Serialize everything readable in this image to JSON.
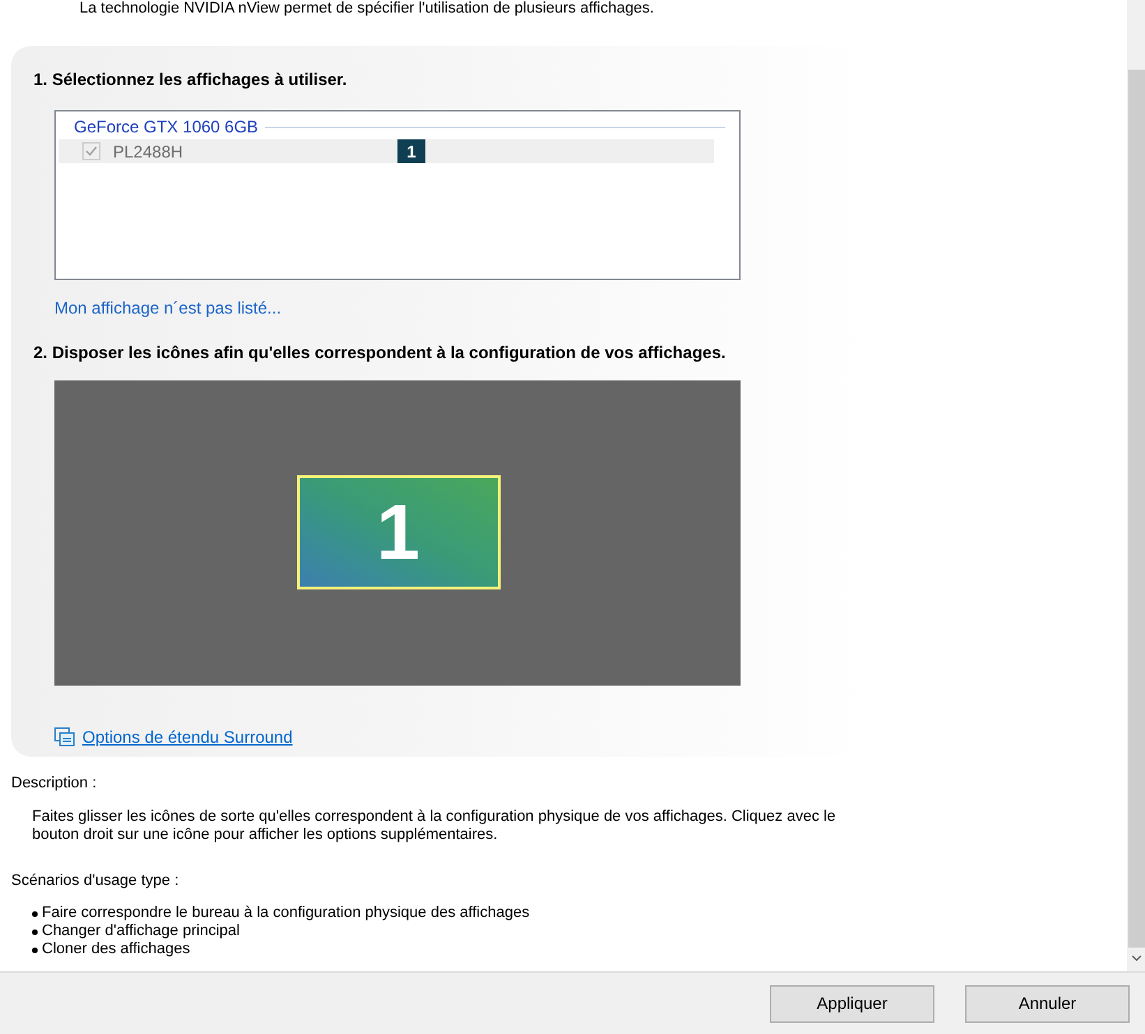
{
  "intro": "La technologie NVIDIA nView permet de spécifier l'utilisation de plusieurs affichages.",
  "step1": {
    "title": "1. Sélectionnez les affichages à utiliser.",
    "gpus": [
      {
        "name": "GeForce GTX 1060 6GB",
        "displays": [
          {
            "name": "PL2488H",
            "checked": true,
            "disabled": true,
            "selected": true,
            "badge": "1"
          }
        ]
      }
    ],
    "link": "Mon affichage n´est pas listé..."
  },
  "step2": {
    "title": "2. Disposer les icônes afin qu'elles correspondent à la configuration de vos affichages.",
    "monitors": [
      {
        "label": "1",
        "selected": true
      }
    ]
  },
  "surround_link": "Options de étendu Surround",
  "description": {
    "label": "Description :",
    "text": "Faites glisser les icônes de sorte qu'elles correspondent à la configuration physique de vos affichages. Cliquez avec le bouton droit sur une icône pour afficher les options supplémentaires."
  },
  "scenarios": {
    "label": "Scénarios d'usage type :",
    "items": [
      "Faire correspondre le bureau à la configuration physique des affichages",
      "Changer d'affichage principal",
      "Cloner des affichages"
    ]
  },
  "buttons": [
    "Appliquer",
    "Annuler"
  ]
}
